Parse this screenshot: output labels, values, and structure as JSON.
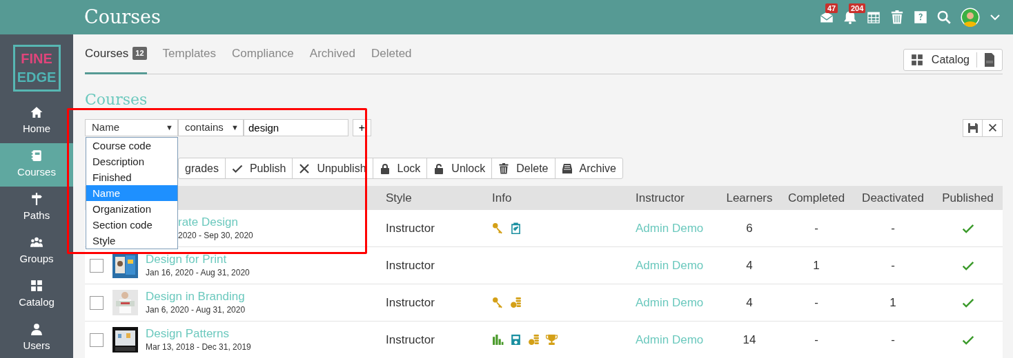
{
  "header": {
    "title": "Courses",
    "mail_count": "47",
    "notification_count": "204"
  },
  "sidebar": {
    "logo": {
      "line_1": "FINE",
      "line_2": "EDGE"
    },
    "items": [
      {
        "label": "Home",
        "kind": "home",
        "selected": false
      },
      {
        "label": "Courses",
        "kind": "book",
        "selected": true
      },
      {
        "label": "Paths",
        "kind": "signpost",
        "selected": false
      },
      {
        "label": "Groups",
        "kind": "group",
        "selected": false
      },
      {
        "label": "Catalog",
        "kind": "grid",
        "selected": false
      },
      {
        "label": "Users",
        "kind": "user",
        "selected": false
      }
    ]
  },
  "tabs": [
    {
      "label": "Courses",
      "count": "12",
      "selected": true
    },
    {
      "label": "Templates",
      "selected": false
    },
    {
      "label": "Compliance",
      "selected": false
    },
    {
      "label": "Archived",
      "selected": false
    },
    {
      "label": "Deleted",
      "selected": false
    }
  ],
  "catalog_button": "Catalog",
  "section_title": "Courses",
  "filter": {
    "field": "Name",
    "operator": "contains",
    "arrow": "▼",
    "value": "design",
    "add_button": "+",
    "options": [
      {
        "label": "Course code",
        "selected": false
      },
      {
        "label": "Description",
        "selected": false
      },
      {
        "label": "Finished",
        "selected": false
      },
      {
        "label": "Name",
        "selected": true
      },
      {
        "label": "Organization",
        "selected": false
      },
      {
        "label": "Section code",
        "selected": false
      },
      {
        "label": "Style",
        "selected": false
      }
    ]
  },
  "toolbar": [
    {
      "label": "grades",
      "kind": "covered"
    },
    {
      "label": "Publish",
      "kind": "check"
    },
    {
      "label": "Unpublish",
      "kind": "cross"
    },
    {
      "label": "Lock",
      "kind": "lock"
    },
    {
      "label": "Unlock",
      "kind": "unlock"
    },
    {
      "label": "Delete",
      "kind": "trash"
    },
    {
      "label": "Archive",
      "kind": "archive"
    }
  ],
  "table": {
    "columns": [
      "Style",
      "Info",
      "Instructor",
      "Learners",
      "Completed",
      "Deactivated",
      "Published"
    ],
    "rows": [
      {
        "kind": "covered",
        "title": "rate Design",
        "dates": "2020 - Sep 30, 2020",
        "style": "Instructor",
        "info": [
          {
            "kind": "key"
          },
          {
            "kind": "clipboard"
          }
        ],
        "instructor": "Admin Demo",
        "learners": "6",
        "completed": "-",
        "deactivated": "-",
        "published": true
      },
      {
        "kind": "full",
        "checked": false,
        "title": "Design for Print",
        "dates": "Jan 16, 2020 - Aug 31, 2020",
        "style": "Instructor",
        "info": [],
        "instructor": "Admin Demo",
        "learners": "4",
        "completed": "1",
        "deactivated": "-",
        "published": true
      },
      {
        "kind": "full",
        "checked": false,
        "title": "Design in Branding",
        "dates": "Jan 6, 2020 - Aug 31, 2020",
        "style": "Instructor",
        "info": [
          {
            "kind": "key"
          },
          {
            "kind": "coins"
          }
        ],
        "instructor": "Admin Demo",
        "learners": "4",
        "completed": "-",
        "deactivated": "1",
        "published": true
      },
      {
        "kind": "full",
        "checked": false,
        "title": "Design Patterns",
        "dates": "Mar 13, 2018 - Dec 31, 2019",
        "style": "Instructor",
        "info": [
          {
            "kind": "chart"
          },
          {
            "kind": "certificate"
          },
          {
            "kind": "coins"
          },
          {
            "kind": "trophy"
          }
        ],
        "instructor": "Admin Demo",
        "learners": "14",
        "completed": "-",
        "deactivated": "-",
        "published": true
      }
    ]
  }
}
